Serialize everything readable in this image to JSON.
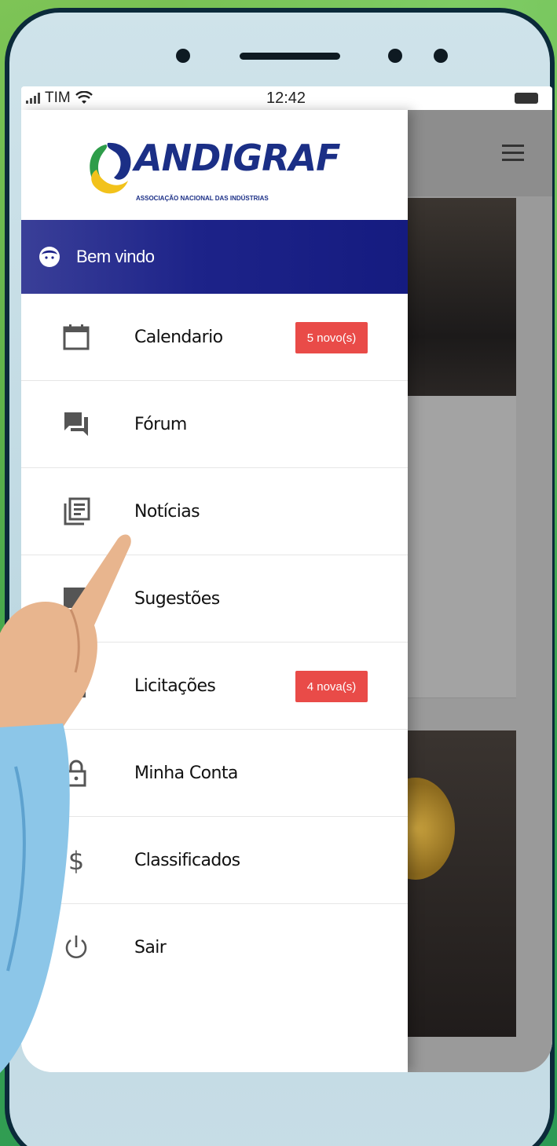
{
  "status_bar": {
    "carrier": "TIM",
    "time": "12:42"
  },
  "brand": {
    "name": "ANDIGRAF",
    "subtitle": "ASSOCIAÇÃO NACIONAL DAS INDÚSTRIAS",
    "primary_color": "#1b2f86",
    "accent_color": "#e94b48"
  },
  "drawer": {
    "welcome": "Bem vindo",
    "items": [
      {
        "label": "Calendario",
        "icon": "calendar-icon",
        "badge": "5 novo(s)"
      },
      {
        "label": "Fórum",
        "icon": "forum-icon"
      },
      {
        "label": "Notícias",
        "icon": "news-icon"
      },
      {
        "label": "Sugestões",
        "icon": "suggestion-icon"
      },
      {
        "label": "Licitações",
        "icon": "bidding-icon",
        "badge": "4 nova(s)"
      },
      {
        "label": "Minha Conta",
        "icon": "lock-icon"
      },
      {
        "label": "Classificados",
        "icon": "dollar-icon"
      },
      {
        "label": "Sair",
        "icon": "power-icon"
      }
    ]
  }
}
